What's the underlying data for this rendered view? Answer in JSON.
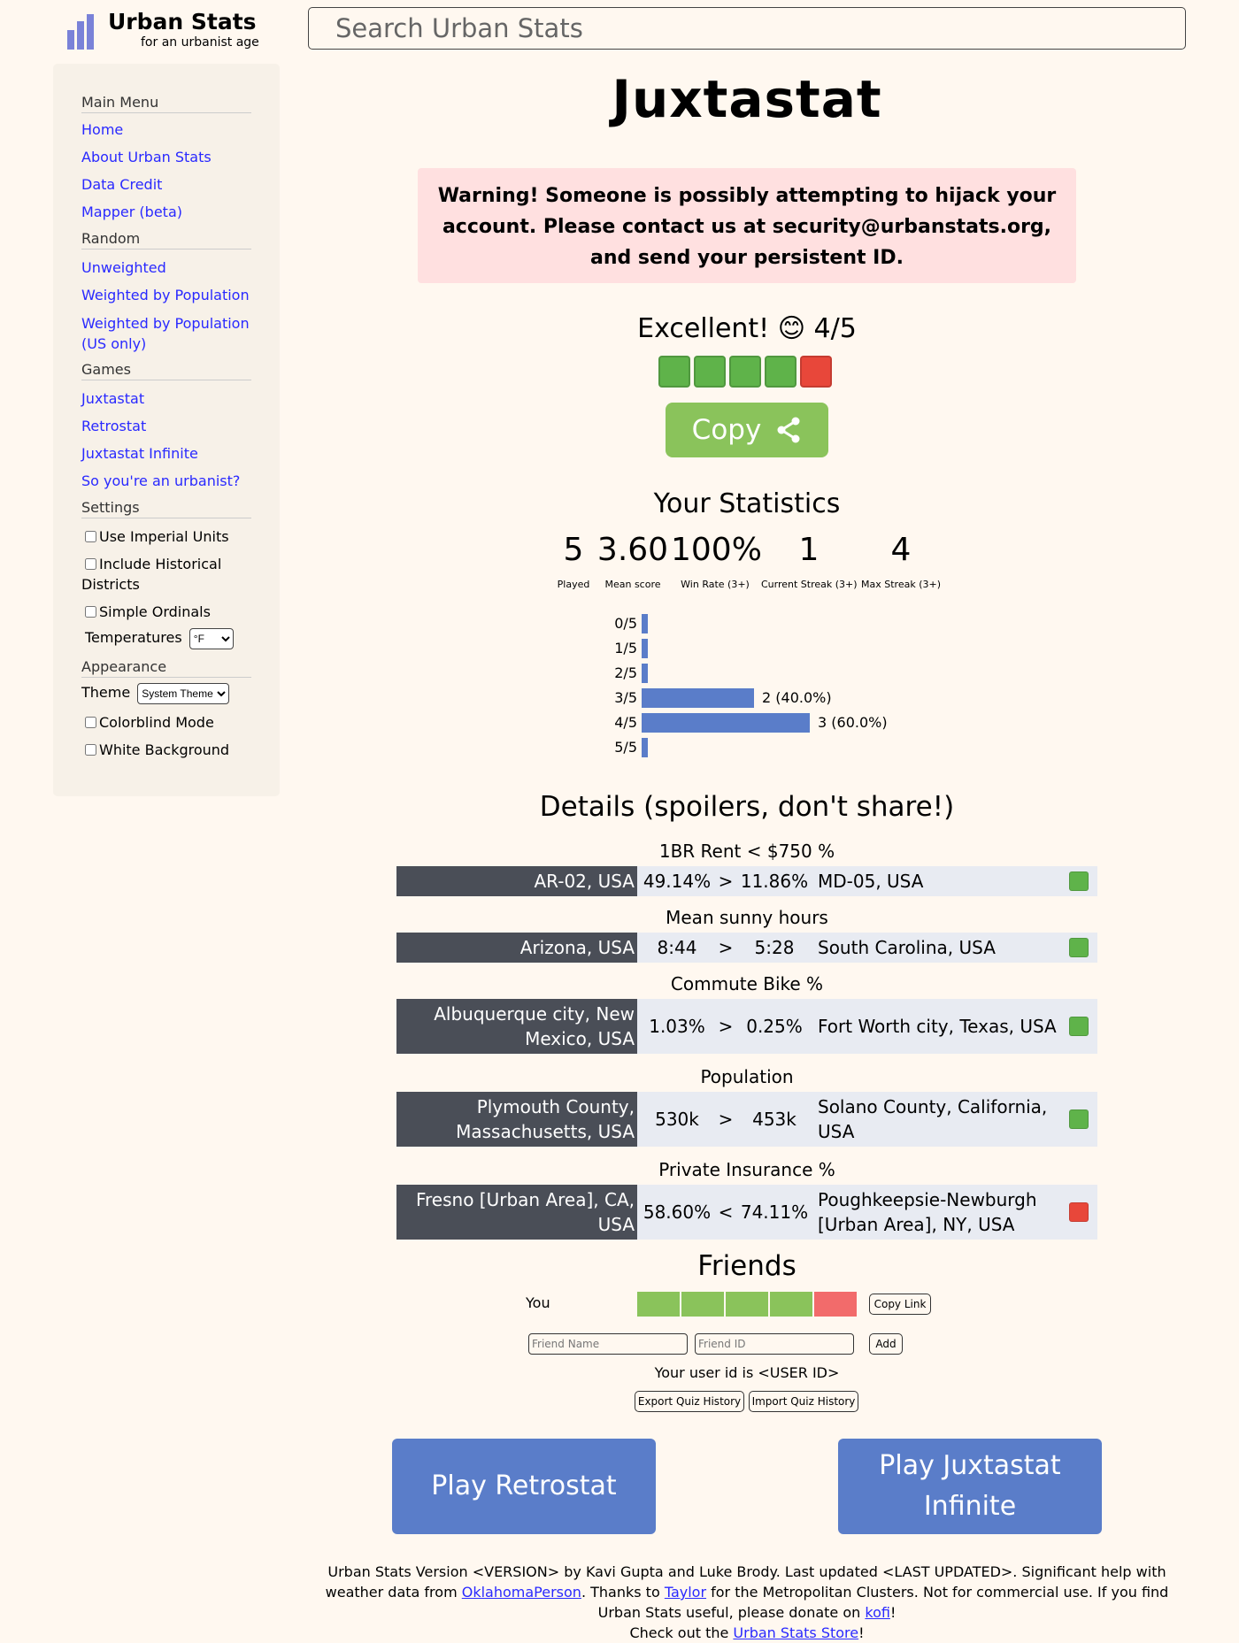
{
  "header": {
    "logo_title": "Urban Stats",
    "logo_tagline": "for an urbanist age",
    "search_placeholder": "Search Urban Stats"
  },
  "sidebar": {
    "main_menu": {
      "title": "Main Menu",
      "items": [
        "Home",
        "About Urban Stats",
        "Data Credit",
        "Mapper (beta)"
      ]
    },
    "random": {
      "title": "Random",
      "items": [
        "Unweighted",
        "Weighted by Population",
        "Weighted by Population (US only)"
      ]
    },
    "games": {
      "title": "Games",
      "items": [
        "Juxtastat",
        "Retrostat",
        "Juxtastat Infinite",
        "So you're an urbanist?"
      ]
    },
    "settings": {
      "title": "Settings",
      "use_imperial": "Use Imperial Units",
      "include_historical": "Include Historical Districts",
      "simple_ordinals": "Simple Ordinals",
      "temperatures_label": "Temperatures",
      "temperatures_value": "°F"
    },
    "appearance": {
      "title": "Appearance",
      "theme_label": "Theme",
      "theme_value": "System Theme",
      "colorblind": "Colorblind Mode",
      "white_background": "White Background"
    }
  },
  "main": {
    "title": "Juxtastat",
    "warning": "Warning! Someone is possibly attempting to hijack your account. Please contact us at security@urbanstats.org, and send your persistent ID.",
    "score_text": "Excellent! 😊 4/5",
    "result_squares": [
      "green",
      "green",
      "green",
      "green",
      "red"
    ],
    "copy_label": "Copy",
    "stats_title": "Your Statistics",
    "stats": [
      {
        "value": "5",
        "label": "Played"
      },
      {
        "value": "3.60",
        "label": "Mean score"
      },
      {
        "value": "100%",
        "label": "Win Rate (3+)"
      },
      {
        "value": "1",
        "label": "Current Streak (3+)"
      },
      {
        "value": "4",
        "label": "Max Streak (3+)"
      }
    ],
    "histogram": [
      {
        "label": "0/5",
        "count": 0,
        "text": ""
      },
      {
        "label": "1/5",
        "count": 0,
        "text": ""
      },
      {
        "label": "2/5",
        "count": 0,
        "text": ""
      },
      {
        "label": "3/5",
        "count": 2,
        "text": "2 (40.0%)"
      },
      {
        "label": "4/5",
        "count": 3,
        "text": "3 (60.0%)"
      },
      {
        "label": "5/5",
        "count": 0,
        "text": ""
      }
    ],
    "details_title": "Details (spoilers, don't share!)",
    "questions": [
      {
        "stat": "1BR Rent < $750 %",
        "left": "AR-02, USA",
        "left_value": "49.14%",
        "op": ">",
        "right_value": "11.86%",
        "right": "MD-05, USA",
        "correct": true
      },
      {
        "stat": "Mean sunny hours",
        "left": "Arizona, USA",
        "left_value": "8:44",
        "op": ">",
        "right_value": "5:28",
        "right": "South Carolina, USA",
        "correct": true
      },
      {
        "stat": "Commute Bike %",
        "left": "Albuquerque city, New Mexico, USA",
        "left_value": "1.03%",
        "op": ">",
        "right_value": "0.25%",
        "right": "Fort Worth city, Texas, USA",
        "correct": true
      },
      {
        "stat": "Population",
        "left": "Plymouth County, Massachusetts, USA",
        "left_value": "530k",
        "op": ">",
        "right_value": "453k",
        "right": "Solano County, California, USA",
        "correct": true
      },
      {
        "stat": "Private Insurance %",
        "left": "Fresno [Urban Area], CA, USA",
        "left_value": "58.60%",
        "op": "<",
        "right_value": "74.11%",
        "right": "Poughkeepsie-Newburgh [Urban Area], NY, USA",
        "correct": false
      }
    ],
    "friends": {
      "title": "Friends",
      "you_label": "You",
      "copy_link": "Copy Link",
      "friend_name_placeholder": "Friend Name",
      "friend_id_placeholder": "Friend ID",
      "add_label": "Add",
      "user_id_text": "Your user id is <USER ID>",
      "export_label": "Export Quiz History",
      "import_label": "Import Quiz History"
    },
    "play_retrostat": "Play Retrostat",
    "play_infinite": "Play Juxtastat Infinite"
  },
  "footer": {
    "text1": "Urban Stats Version <VERSION> by Kavi Gupta and Luke Brody. Last updated <LAST UPDATED>. Significant help with weather data from ",
    "link_oklahoma": "OklahomaPerson",
    "text2": ". Thanks to ",
    "link_taylor": "Taylor",
    "text3": " for the Metropolitan Clusters. Not for commercial use. If you find Urban Stats useful, please donate on ",
    "link_kofi": "kofi",
    "text4": "!",
    "text5": "Check out the ",
    "link_store": "Urban Stats Store",
    "text6": "!"
  },
  "colors": {
    "background": "#fff8f0",
    "sidebar_bg": "#f7f1e8",
    "link": "#2929ff",
    "correct": "#5fb34a",
    "wrong": "#e8473a",
    "copy_button": "#8ac35b",
    "play_button": "#5a7dc9",
    "histogram_bar": "#5a7dc9",
    "region_left_bg": "#4a4e57",
    "region_right_bg": "#e8ebf2",
    "warning_bg": "#ffe0e0"
  }
}
